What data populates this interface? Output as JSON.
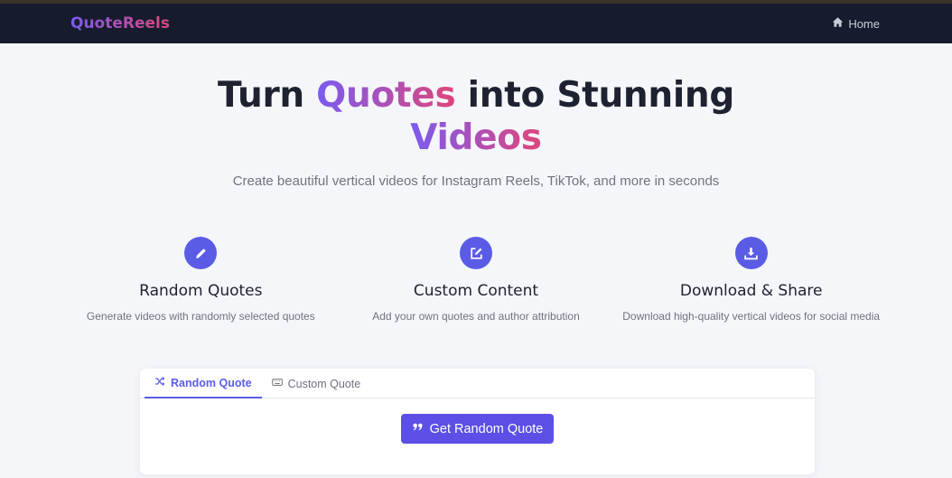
{
  "nav": {
    "brand": "QuoteReels",
    "home_label": "Home",
    "home_icon": "home-icon"
  },
  "hero": {
    "title_part1": "Turn ",
    "title_highlight1": "Quotes",
    "title_part2": " into Stunning",
    "title_highlight2": "Videos",
    "subtitle": "Create beautiful vertical videos for Instagram Reels, TikTok, and more in seconds"
  },
  "features": [
    {
      "icon": "pencil-icon",
      "title": "Random Quotes",
      "desc": "Generate videos with randomly selected quotes"
    },
    {
      "icon": "edit-icon",
      "title": "Custom Content",
      "desc": "Add your own quotes and author attribution"
    },
    {
      "icon": "download-icon",
      "title": "Download & Share",
      "desc": "Download high-quality vertical videos for social media"
    }
  ],
  "tabs": [
    {
      "label": "Random Quote",
      "icon": "shuffle-icon",
      "active": true
    },
    {
      "label": "Custom Quote",
      "icon": "keyboard-icon",
      "active": false
    }
  ],
  "action": {
    "button_label": "Get Random Quote",
    "button_icon": "quote-icon"
  },
  "colors": {
    "navbar": "#161c2d",
    "accent": "#5b5ce6",
    "gradient_start": "#7a5cf0",
    "gradient_end": "#e0457b"
  }
}
